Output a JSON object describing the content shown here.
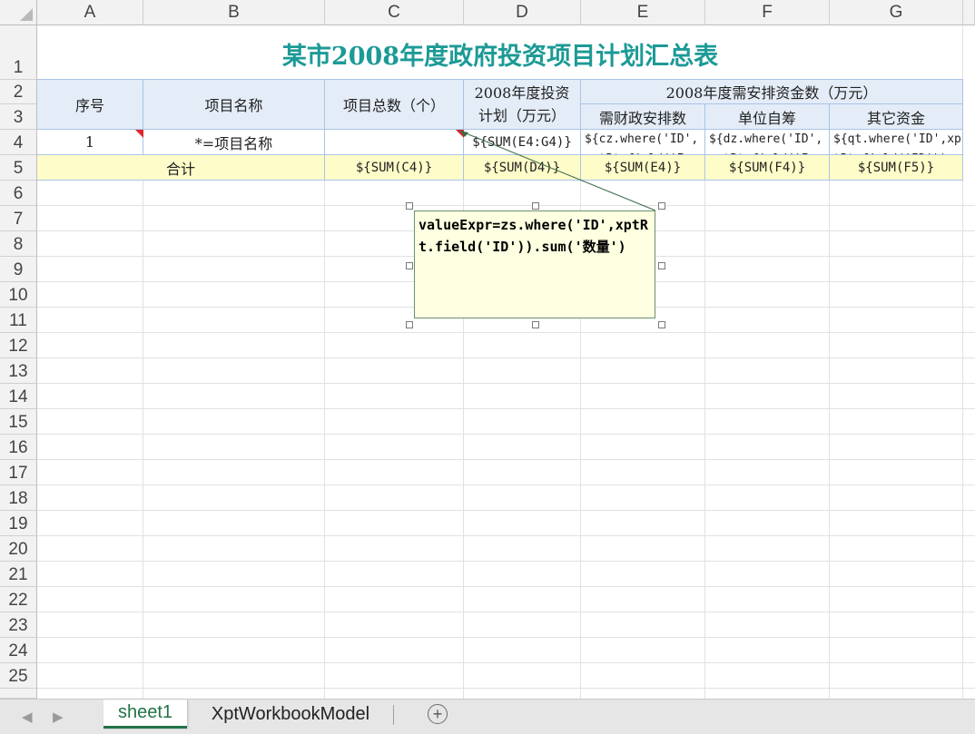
{
  "columns": [
    "A",
    "B",
    "C",
    "D",
    "E",
    "F",
    "G"
  ],
  "rows": [
    "1",
    "2",
    "3",
    "4",
    "5",
    "6",
    "7",
    "8",
    "9",
    "10",
    "11",
    "12",
    "13",
    "14",
    "15",
    "16",
    "17",
    "18",
    "19",
    "20",
    "21",
    "22",
    "23",
    "24",
    "25"
  ],
  "title": "某市2008年度政府投资项目计划汇总表",
  "header": {
    "seq": "序号",
    "project_name": "项目名称",
    "project_count": "项目总数（个）",
    "plan": "2008年度投资计划（万元）",
    "funding_group": "2008年度需安排资金数（万元）",
    "fiscal": "需财政安排数",
    "self_raised": "单位自筹",
    "other": "其它资金"
  },
  "data_row": {
    "seq": "1",
    "project_name": "*=项目名称",
    "project_count": "",
    "plan": "${SUM(E4:G4)}",
    "fiscal": "${cz.where('ID',xptRt.field('ID')).sum('数量')}",
    "self_raised": "${dz.where('ID',xptRt.field('ID')).sum('数量')}",
    "other": "${qt.where('ID',xptRt.field('ID')).sum('数量')}"
  },
  "total_row": {
    "label": "合计",
    "project_count": "${SUM(C4)}",
    "plan": "${SUM(D4)}",
    "fiscal": "${SUM(E4)}",
    "self_raised": "${SUM(F4)}",
    "other": "${SUM(F5)}"
  },
  "comment": {
    "text": "valueExpr=zs.where('ID',xptRt.field('ID')).sum('数量')"
  },
  "tabs": {
    "sheet1": "sheet1",
    "model": "XptWorkbookModel",
    "add_symbol": "+",
    "prev_symbol": "◀",
    "next_symbol": "▶"
  },
  "colors": {
    "title": "#1c9a96",
    "header_fill": "#e4ecf7",
    "total_fill": "#fefdc9",
    "comment_fill": "#ffffe1",
    "error_marker": "#e0262a",
    "active_tab": "#217346"
  }
}
